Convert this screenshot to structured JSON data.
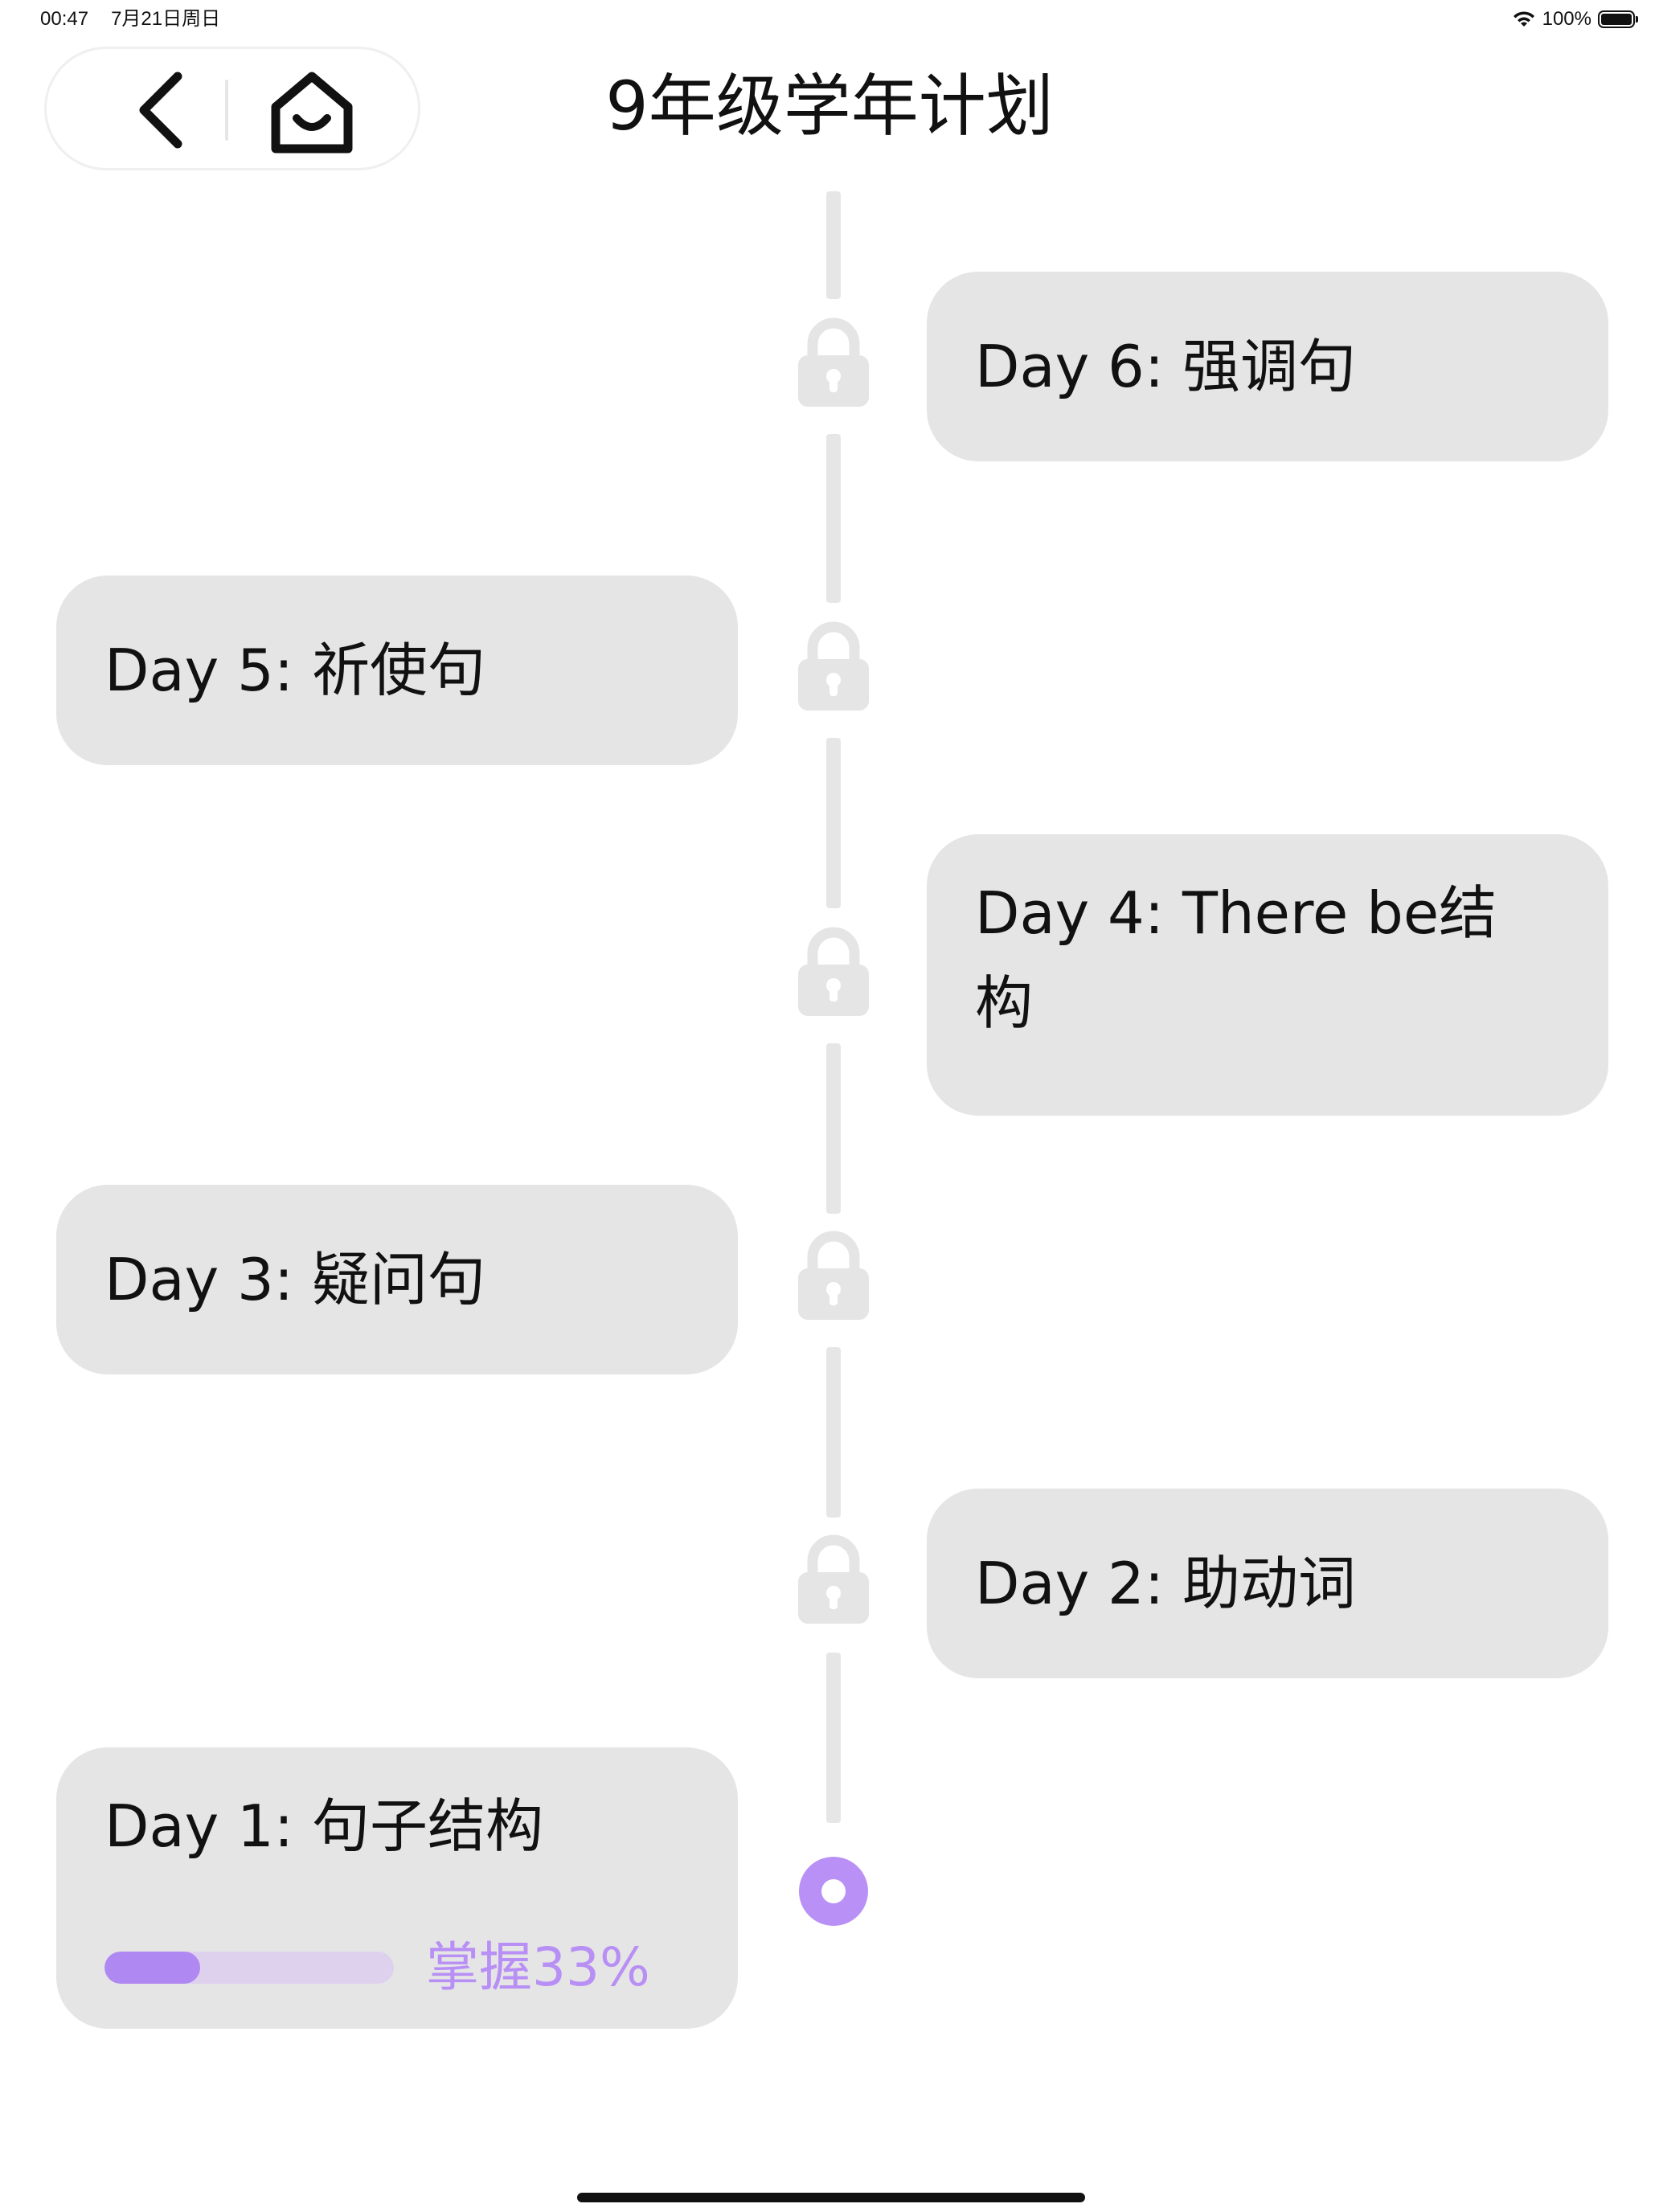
{
  "status_bar": {
    "time": "00:47",
    "date": "7月21日周日",
    "battery": "100%"
  },
  "header": {
    "title": "9年级学年计划"
  },
  "days": [
    {
      "label": "Day 6: 强调句",
      "locked": true
    },
    {
      "label": "Day 5: 祈使句",
      "locked": true
    },
    {
      "label": "Day 4: There be结构",
      "locked": true
    },
    {
      "label": "Day 3: 疑问句",
      "locked": true
    },
    {
      "label": "Day 2: 助动词",
      "locked": true
    },
    {
      "label": "Day 1: 句子结构",
      "locked": false,
      "progress_text": "掌握33%",
      "progress": 0.33
    }
  ],
  "colors": {
    "accent": "#b990f5",
    "card": "#e5e5e5",
    "connector": "#e6e6e6"
  }
}
